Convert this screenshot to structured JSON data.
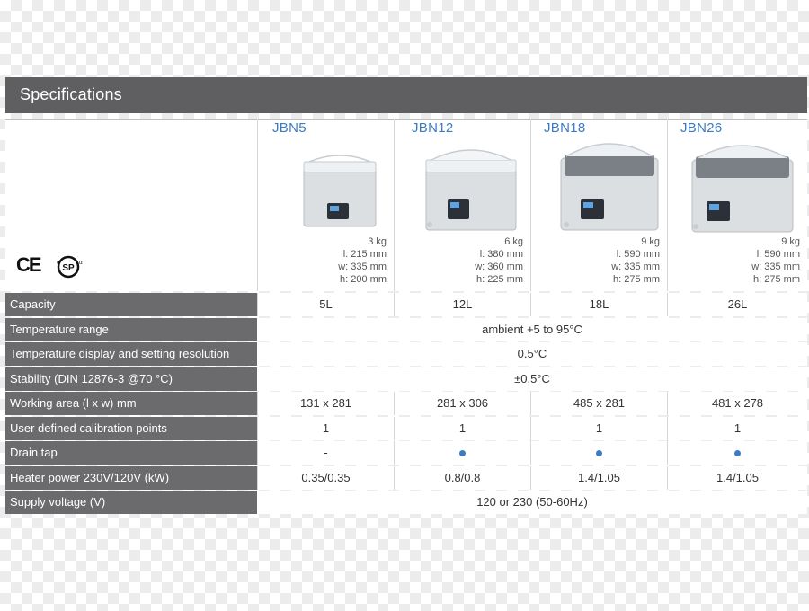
{
  "header": {
    "title": "Specifications"
  },
  "certifications": {
    "ce": "CE",
    "csa": "CSA"
  },
  "models": [
    {
      "name": "JBN5",
      "weight": "3 kg",
      "length": "l: 215 mm",
      "width": "w: 335 mm",
      "height": "h: 200 mm"
    },
    {
      "name": "JBN12",
      "weight": "6 kg",
      "length": "l: 380 mm",
      "width": "w: 360 mm",
      "height": "h:  225 mm"
    },
    {
      "name": "JBN18",
      "weight": "9 kg",
      "length": "l: 590 mm",
      "width": "w: 335 mm",
      "height": "h:  275 mm"
    },
    {
      "name": "JBN26",
      "weight": "9 kg",
      "length": "l: 590 mm",
      "width": "w: 335 mm",
      "height": "h:  275 mm"
    }
  ],
  "rows": [
    {
      "label": "Capacity",
      "values": [
        "5L",
        "12L",
        "18L",
        "26L"
      ]
    },
    {
      "label": "Temperature range",
      "span": "ambient +5 to 95°C"
    },
    {
      "label": "Temperature display and setting resolution",
      "span": "0.5°C"
    },
    {
      "label": "Stability (DIN 12876-3 @70 °C)",
      "span": "±0.5°C"
    },
    {
      "label": "Working area (l x w) mm",
      "values": [
        "131 x 281",
        "281 x 306",
        "485 x 281",
        "481 x 278"
      ]
    },
    {
      "label": "User defined calibration points",
      "values": [
        "1",
        "1",
        "1",
        "1"
      ]
    },
    {
      "label": "Drain tap",
      "values": [
        "-",
        "",
        "",
        ""
      ],
      "dots": [
        false,
        true,
        true,
        true
      ]
    },
    {
      "label": "Heater power 230V/120V (kW)",
      "values": [
        "0.35/0.35",
        "0.8/0.8",
        "1.4/1.05",
        "1.4/1.05"
      ]
    },
    {
      "label": "Supply voltage (V)",
      "span": "120 or 230 (50-60Hz)"
    }
  ],
  "colors": {
    "header_bg": "#5f5f61",
    "label_bg": "#6b6b6d",
    "accent": "#3c7bc4"
  }
}
